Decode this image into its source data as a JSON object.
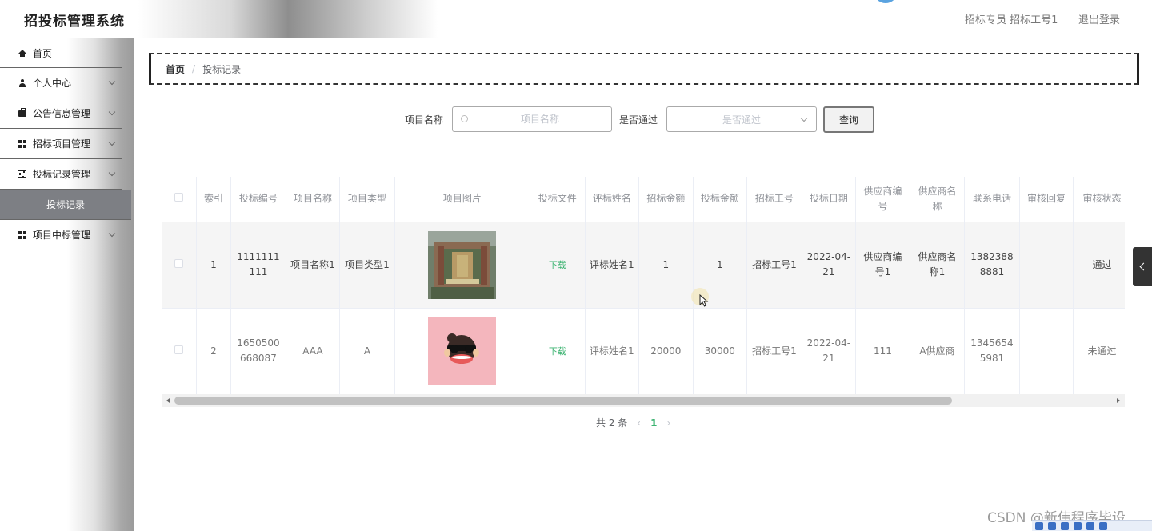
{
  "header": {
    "title": "招投标管理系统",
    "user": "招标专员  招标工号1",
    "logout": "退出登录"
  },
  "sidebar": {
    "items": [
      {
        "label": "首页",
        "icon": "home-icon",
        "expandable": false
      },
      {
        "label": "个人中心",
        "icon": "user-icon",
        "expandable": true
      },
      {
        "label": "公告信息管理",
        "icon": "briefcase-icon",
        "expandable": true
      },
      {
        "label": "招标项目管理",
        "icon": "grid-icon",
        "expandable": true
      },
      {
        "label": "投标记录管理",
        "icon": "sliders-icon",
        "expandable": true,
        "open": true
      },
      {
        "label": "项目中标管理",
        "icon": "grid-icon",
        "expandable": true
      }
    ],
    "sub_items": [
      "投标记录"
    ]
  },
  "breadcrumb": {
    "home": "首页",
    "separator": "/",
    "current": "投标记录"
  },
  "search": {
    "name_label": "项目名称",
    "name_placeholder": "项目名称",
    "pass_label": "是否通过",
    "pass_placeholder": "是否通过",
    "button": "查询"
  },
  "table": {
    "headers": [
      "索引",
      "投标编号",
      "项目名称",
      "项目类型",
      "项目图片",
      "投标文件",
      "评标姓名",
      "招标金额",
      "投标金额",
      "招标工号",
      "投标日期",
      "供应商编号",
      "供应商名称",
      "联系电话",
      "审核回复",
      "审核状态"
    ],
    "rows": [
      {
        "index": "1",
        "bid_no": "1111111111",
        "project_name": "项目名称1",
        "project_type": "项目类型1",
        "image": "aerial-campus-photo",
        "file": "下载",
        "evaluator": "评标姓名1",
        "tender_amount": "1",
        "bid_amount": "1",
        "tender_id": "招标工号1",
        "date": "2022-04-21",
        "supplier_no": "供应商编号1",
        "supplier_name": "供应商名称1",
        "phone": "13823888881",
        "reply": "",
        "status": "通过"
      },
      {
        "index": "2",
        "bid_no": "1650500668087",
        "project_name": "AAA",
        "project_type": "A",
        "image": "monkey-cartoon-image",
        "file": "下载",
        "evaluator": "评标姓名1",
        "tender_amount": "20000",
        "bid_amount": "30000",
        "tender_id": "招标工号1",
        "date": "2022-04-21",
        "supplier_no": "111",
        "supplier_name": "A供应商",
        "phone": "13456545981",
        "reply": "",
        "status": "未通过"
      }
    ]
  },
  "pagination": {
    "total_text": "共 2 条",
    "prev": "‹",
    "current": "1",
    "next": "›"
  },
  "watermark": "CSDN @新伟程序毕设",
  "colors": {
    "accent_green": "#3cb371",
    "submenu_active_bg": "#7d7f84"
  }
}
